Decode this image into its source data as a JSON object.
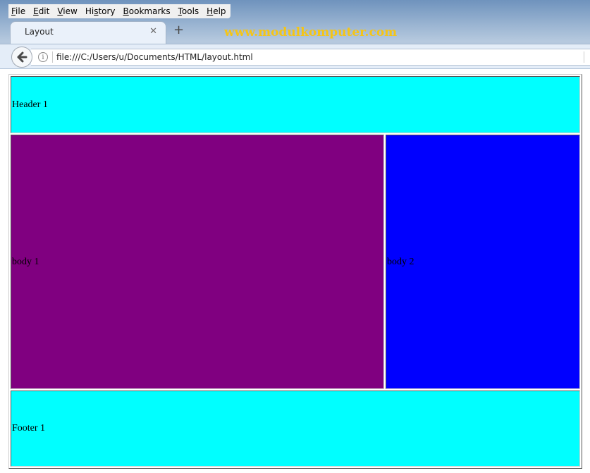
{
  "browser": {
    "menu": [
      {
        "label": "File",
        "accel": "F"
      },
      {
        "label": "Edit",
        "accel": "E"
      },
      {
        "label": "View",
        "accel": "V"
      },
      {
        "label": "History",
        "accel": "s"
      },
      {
        "label": "Bookmarks",
        "accel": "B"
      },
      {
        "label": "Tools",
        "accel": "T"
      },
      {
        "label": "Help",
        "accel": "H"
      }
    ],
    "tab": {
      "title": "Layout",
      "close_glyph": "✕"
    },
    "new_tab_glyph": "+",
    "watermark": "www.modulkomputer.com",
    "url": "file:///C:/Users/u/Documents/HTML/layout.html",
    "icons": {
      "back": "back-arrow-icon",
      "info": "info-icon"
    }
  },
  "page": {
    "header": "Header 1",
    "body1": "body 1",
    "body2": "body 2",
    "footer": "Footer 1",
    "colors": {
      "header": "#00ffff",
      "body1": "#800080",
      "body2": "#0000ff",
      "footer": "#00ffff"
    }
  }
}
